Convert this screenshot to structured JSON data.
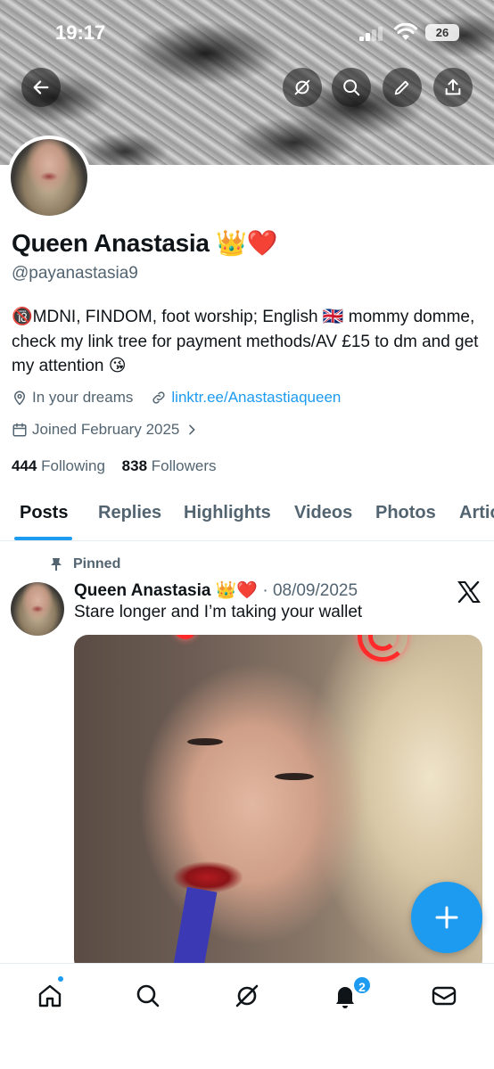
{
  "status_bar": {
    "time": "19:17",
    "battery": "26"
  },
  "profile": {
    "name": "Queen Anastasia 👑❤️",
    "handle": "@payanastasia9",
    "bio": "🔞MDNI, FINDOM, foot worship; English 🇬🇧 mommy domme, check my link tree for payment methods/AV £15 to dm and get my attention 😘",
    "location": "In your dreams",
    "link": "linktr.ee/Anastastiaqueen",
    "joined": "Joined February 2025",
    "following_count": "444",
    "following_label": "Following",
    "followers_count": "838",
    "followers_label": "Followers"
  },
  "tabs": [
    {
      "label": "Posts",
      "active": true
    },
    {
      "label": "Replies",
      "active": false
    },
    {
      "label": "Highlights",
      "active": false
    },
    {
      "label": "Videos",
      "active": false
    },
    {
      "label": "Photos",
      "active": false
    },
    {
      "label": "Articles",
      "active": false
    }
  ],
  "post": {
    "pinned_label": "Pinned",
    "author": "Queen Anastasia 👑❤️",
    "date": "· 08/09/2025",
    "text": "Stare longer and I’m taking your wallet"
  },
  "bottom_nav": {
    "notification_count": "2"
  },
  "colors": {
    "accent": "#1d9bf0",
    "text": "#0f1419",
    "secondary": "#536471"
  },
  "icons": [
    "back-arrow-icon",
    "grok-icon",
    "search-icon",
    "edit-icon",
    "share-icon",
    "location-icon",
    "link-icon",
    "calendar-icon",
    "pin-icon",
    "x-logo-icon",
    "plus-icon",
    "home-icon",
    "notifications-icon",
    "messages-icon"
  ]
}
